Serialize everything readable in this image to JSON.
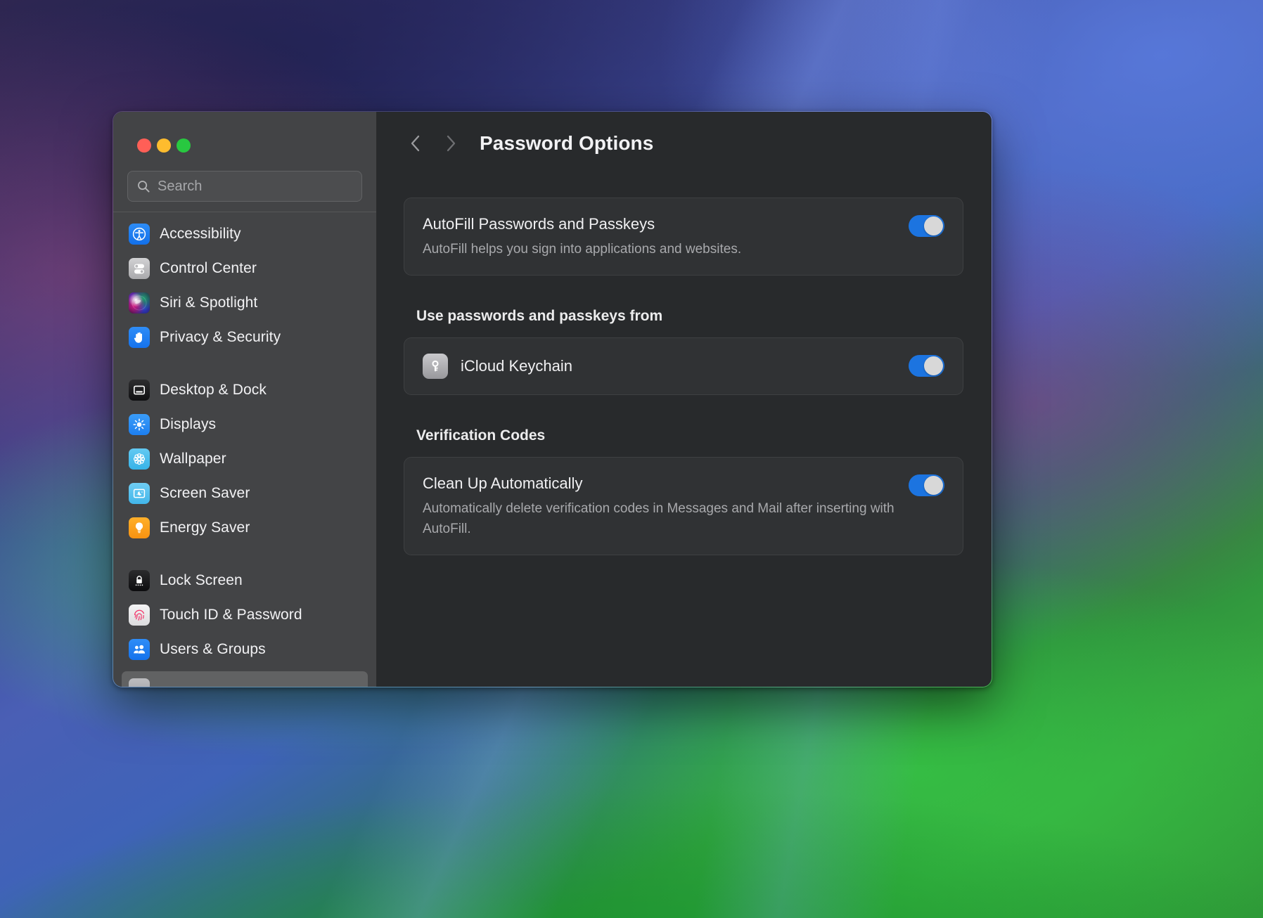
{
  "window": {
    "traffic_lights": {
      "close_label": "Close",
      "minimize_label": "Minimize",
      "maximize_label": "Maximize"
    }
  },
  "sidebar": {
    "search": {
      "placeholder": "Search",
      "value": "",
      "icon": "search-icon"
    },
    "groups": [
      {
        "items": [
          {
            "label": "Accessibility",
            "icon": "accessibility-icon",
            "selected": false
          },
          {
            "label": "Control Center",
            "icon": "control-center-icon",
            "selected": false
          },
          {
            "label": "Siri & Spotlight",
            "icon": "siri-icon",
            "selected": false
          },
          {
            "label": "Privacy & Security",
            "icon": "privacy-hand-icon",
            "selected": false
          }
        ]
      },
      {
        "items": [
          {
            "label": "Desktop & Dock",
            "icon": "desktop-dock-icon",
            "selected": false
          },
          {
            "label": "Displays",
            "icon": "display-brightness-icon",
            "selected": false
          },
          {
            "label": "Wallpaper",
            "icon": "wallpaper-flower-icon",
            "selected": false
          },
          {
            "label": "Screen Saver",
            "icon": "screen-saver-icon",
            "selected": false
          },
          {
            "label": "Energy Saver",
            "icon": "lightbulb-icon",
            "selected": false
          }
        ]
      },
      {
        "items": [
          {
            "label": "Lock Screen",
            "icon": "lock-icon",
            "selected": false
          },
          {
            "label": "Touch ID & Password",
            "icon": "fingerprint-icon",
            "selected": false
          },
          {
            "label": "Users & Groups",
            "icon": "users-icon",
            "selected": false
          }
        ]
      }
    ]
  },
  "header": {
    "title": "Password Options",
    "back_label": "Back",
    "forward_label": "Forward"
  },
  "main": {
    "autofill": {
      "title": "AutoFill Passwords and Passkeys",
      "subtitle": "AutoFill helps you sign into applications and websites.",
      "toggle_on": true
    },
    "sources_section": {
      "heading": "Use passwords and passkeys from",
      "items": [
        {
          "label": "iCloud Keychain",
          "icon": "key-icon",
          "toggle_on": true
        }
      ]
    },
    "verification_section": {
      "heading": "Verification Codes",
      "items": [
        {
          "title": "Clean Up Automatically",
          "subtitle": "Automatically delete verification codes in Messages and Mail after inserting with AutoFill.",
          "toggle_on": true
        }
      ]
    }
  },
  "colors": {
    "accent_blue": "#1c74e0",
    "window_sidebar": "#434446",
    "window_main": "#282a2c",
    "card": "#303234",
    "text_primary": "#f0f0f2",
    "text_secondary": "#a8a9ac",
    "traffic_close": "#ff5f57",
    "traffic_min": "#febc2e",
    "traffic_max": "#28c840"
  }
}
